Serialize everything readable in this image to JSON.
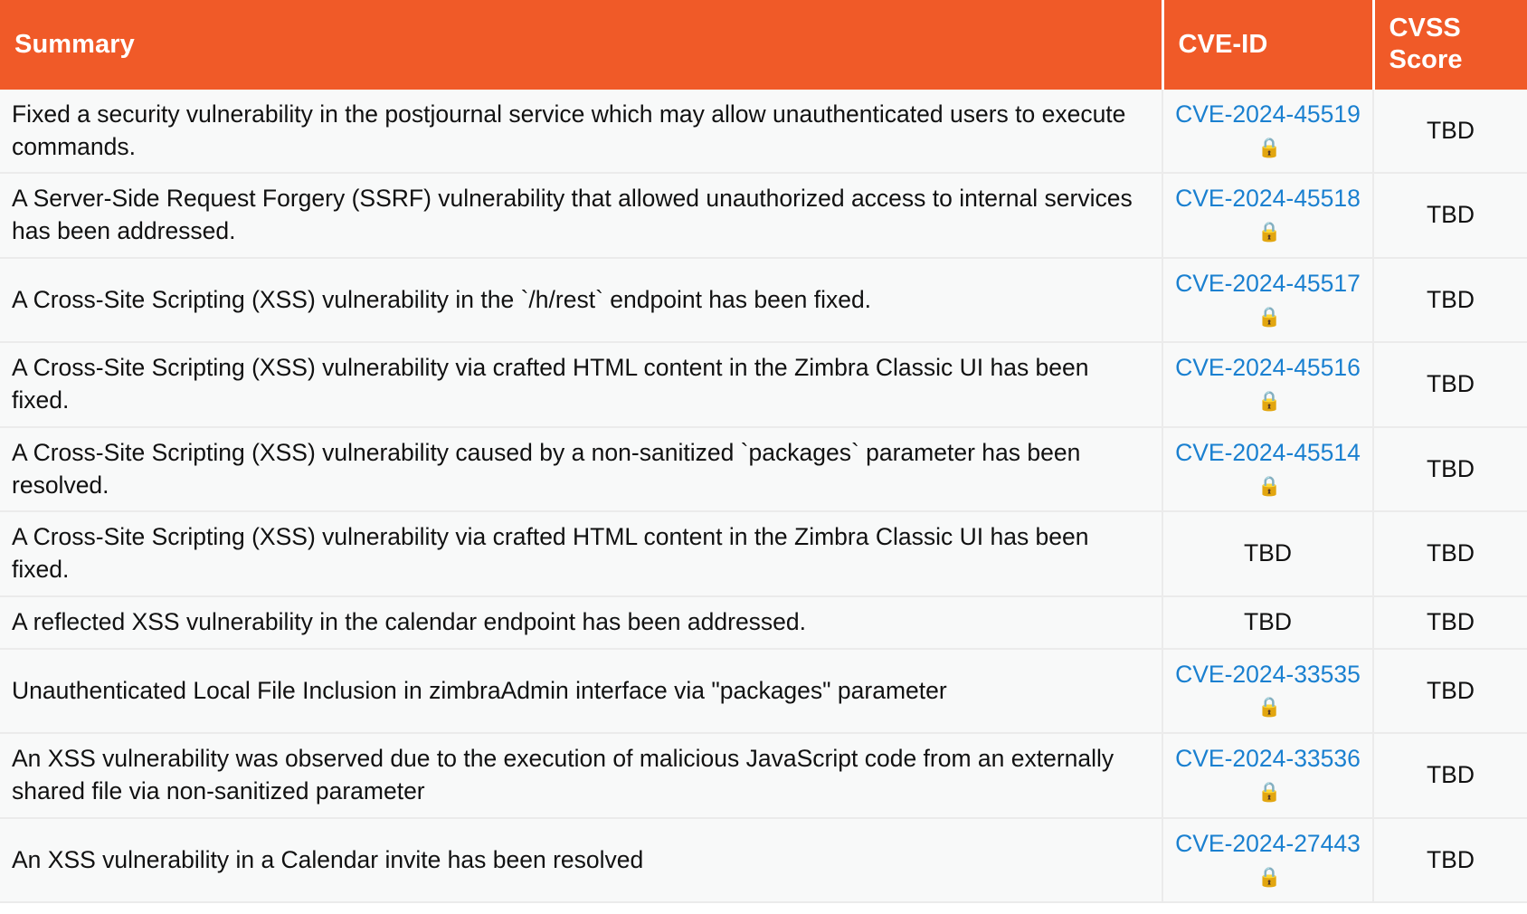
{
  "table": {
    "columns": [
      {
        "key": "summary",
        "label": "Summary",
        "align": "left"
      },
      {
        "key": "cve_id",
        "label": "CVE-ID",
        "align": "center"
      },
      {
        "key": "cvss_score",
        "label": "CVSS Score",
        "align": "center"
      }
    ],
    "header_background": "#f05a28",
    "header_text_color": "#ffffff",
    "link_color": "#1a80d0",
    "row_background": "#f8f9f9",
    "lock_icon": "lock-icon",
    "lock_glyph": "🔒",
    "rows": [
      {
        "summary": "Fixed a security vulnerability in the postjournal service which may allow unauthenticated users to execute commands.",
        "cve_id": "CVE-2024-45519",
        "cve_is_link": true,
        "cve_locked": true,
        "cvss_score": "TBD"
      },
      {
        "summary": "A Server-Side Request Forgery (SSRF) vulnerability that allowed unauthorized access to internal services has been addressed.",
        "cve_id": "CVE-2024-45518",
        "cve_is_link": true,
        "cve_locked": true,
        "cvss_score": "TBD"
      },
      {
        "summary": "A Cross-Site Scripting (XSS) vulnerability in the `/h/rest` endpoint has been fixed.",
        "cve_id": "CVE-2024-45517",
        "cve_is_link": true,
        "cve_locked": true,
        "cvss_score": "TBD"
      },
      {
        "summary": "A Cross-Site Scripting (XSS) vulnerability via crafted HTML content in the Zimbra Classic UI has been fixed.",
        "cve_id": "CVE-2024-45516",
        "cve_is_link": true,
        "cve_locked": true,
        "cvss_score": "TBD"
      },
      {
        "summary": "A Cross-Site Scripting (XSS) vulnerability caused by a non-sanitized `packages` parameter has been resolved.",
        "cve_id": "CVE-2024-45514",
        "cve_is_link": true,
        "cve_locked": true,
        "cvss_score": "TBD"
      },
      {
        "summary": "A Cross-Site Scripting (XSS) vulnerability via crafted HTML content in the Zimbra Classic UI has been fixed.",
        "cve_id": "TBD",
        "cve_is_link": false,
        "cve_locked": false,
        "cvss_score": "TBD"
      },
      {
        "summary": "A reflected XSS vulnerability in the calendar endpoint has been addressed.",
        "cve_id": "TBD",
        "cve_is_link": false,
        "cve_locked": false,
        "cvss_score": "TBD"
      },
      {
        "summary": "Unauthenticated Local File Inclusion in zimbraAdmin interface via \"packages\" parameter",
        "cve_id": "CVE-2024-33535",
        "cve_is_link": true,
        "cve_locked": true,
        "cvss_score": "TBD"
      },
      {
        "summary": "An XSS vulnerability was observed due to the execution of malicious JavaScript code from an externally shared file via non-sanitized parameter",
        "cve_id": "CVE-2024-33536",
        "cve_is_link": true,
        "cve_locked": true,
        "cvss_score": "TBD"
      },
      {
        "summary": "An XSS vulnerability in a Calendar invite has been resolved",
        "cve_id": "CVE-2024-27443",
        "cve_is_link": true,
        "cve_locked": true,
        "cvss_score": "TBD"
      }
    ]
  }
}
